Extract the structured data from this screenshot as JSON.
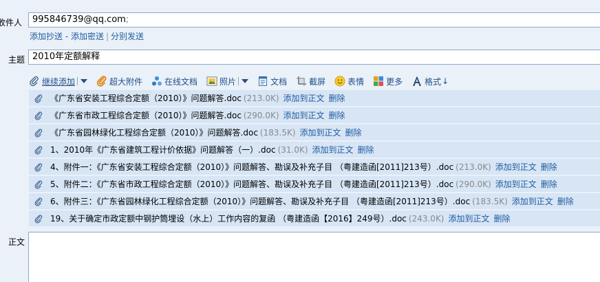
{
  "recipient": {
    "label": "收件人",
    "value": "995846739@qq.com",
    "separator": ";"
  },
  "cc_links": {
    "add_cc": "添加抄送",
    "add_bcc": "添加密送",
    "pipe": "|",
    "separate_send": "分别发送"
  },
  "subject": {
    "label": "主题",
    "value": "2010年定额解释"
  },
  "toolbar": {
    "continue_add": "继续添加",
    "large_attachment": "超大附件",
    "online_doc": "在线文档",
    "photo": "照片",
    "document": "文档",
    "screenshot": "截屏",
    "emoji": "表情",
    "more": "更多",
    "format": "格式"
  },
  "attachments": [
    {
      "name": "《广东省安装工程综合定额（2010）》问题解答.doc",
      "size": "(213.0K)"
    },
    {
      "name": "《广东省市政工程综合定额（2010）》问题解答.doc",
      "size": "(290.0K)"
    },
    {
      "name": "《广东省园林绿化工程综合定额（2010）》问题解答.doc",
      "size": "(183.5K)"
    },
    {
      "name": "1、2010年《广东省建筑工程计价依据》问题解答（一）.doc",
      "size": "(31.0K)"
    },
    {
      "name": "4、附件一：《广东省安装工程综合定额（2010）》问题解答、勘误及补充子目 （粤建造函[2011]213号）.doc",
      "size": "(213.0K)"
    },
    {
      "name": "5、附件二：《广东省市政工程综合定额（2010）》问题解答、勘误及补充子目 （粤建造函[2011]213号）.doc",
      "size": "(290.0K)"
    },
    {
      "name": "6、附件三：《广东省园林绿化工程综合定额（2010）》问题解答、勘误及补充子目 （粤建造函[2011]213号）.doc",
      "size": "(183.5K)"
    },
    {
      "name": "19、关于确定市政定额中钢护筒埋设（水上）工作内容的复函 （粤建造函【2016】249号）.doc",
      "size": "(243.0K)"
    }
  ],
  "attachment_actions": {
    "add_to_body": "添加到正文",
    "delete": "删除"
  },
  "body": {
    "label": "正文"
  },
  "colors": {
    "background": "#eaf1f9",
    "attachment_row": "#d7e5f5",
    "link": "#1f5b9e",
    "border": "#8fa8c8"
  },
  "icons": [
    "paperclip-icon",
    "large-attachment-icon",
    "online-doc-icon",
    "photo-icon",
    "document-icon",
    "screenshot-icon",
    "emoji-icon",
    "more-icon",
    "format-icon",
    "dropdown-arrow-icon"
  ]
}
